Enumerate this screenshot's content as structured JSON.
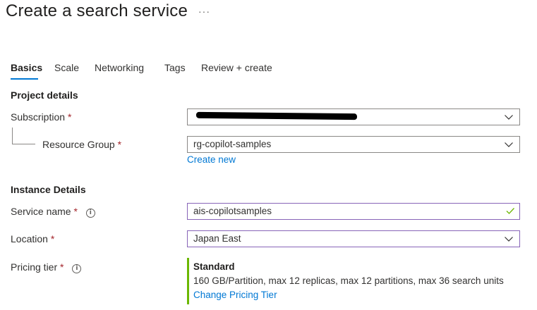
{
  "page": {
    "title": "Create a search service",
    "more_label": "···"
  },
  "tabs": [
    {
      "label": "Basics",
      "active": true
    },
    {
      "label": "Scale",
      "active": false
    },
    {
      "label": "Networking",
      "active": false
    },
    {
      "label": "Tags",
      "active": false
    },
    {
      "label": "Review + create",
      "active": false
    }
  ],
  "project": {
    "heading": "Project details",
    "subscription": {
      "label": "Subscription",
      "required": "*",
      "value": "",
      "value_redacted": true
    },
    "resource_group": {
      "label": "Resource Group",
      "required": "*",
      "value": "rg-copilot-samples",
      "create_new": "Create new"
    }
  },
  "instance": {
    "heading": "Instance Details",
    "service_name": {
      "label": "Service name",
      "required": "*",
      "info": "i",
      "value": "ais-copilotsamples",
      "valid": true
    },
    "location": {
      "label": "Location",
      "required": "*",
      "value": "Japan East"
    },
    "pricing": {
      "label": "Pricing tier",
      "required": "*",
      "info": "i",
      "tier": "Standard",
      "description": "160 GB/Partition, max 12 replicas, max 12 partitions, max 36 search units",
      "change_link": "Change Pricing Tier"
    }
  },
  "colors": {
    "accent": "#0078d4",
    "required": "#a4262c",
    "focus_border": "#8764b8",
    "valid_check": "#6bb700",
    "tier_bar": "#6bb700"
  },
  "icons": {
    "dropdown": "chevron-down-icon",
    "valid": "checkmark-icon",
    "info": "info-icon"
  }
}
